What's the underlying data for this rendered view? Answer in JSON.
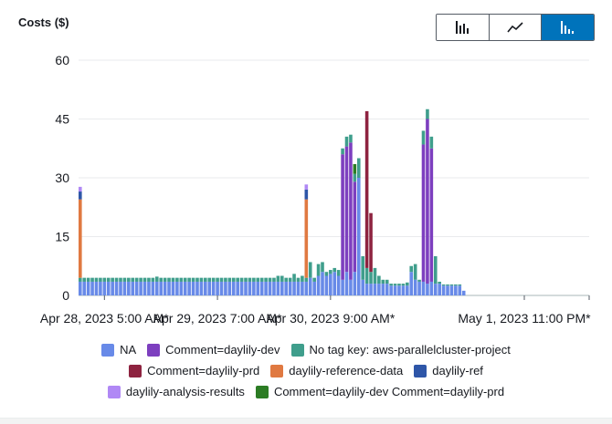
{
  "header": {
    "title": "Costs ($)"
  },
  "toolbar": {
    "buttons": [
      {
        "icon": "bar-chart-icon",
        "active": false
      },
      {
        "icon": "line-chart-icon",
        "active": false
      },
      {
        "icon": "stacked-bar-chart-icon",
        "active": true
      }
    ]
  },
  "chart_data": {
    "type": "bar",
    "stacked": true,
    "ylim": [
      0,
      60
    ],
    "yticks": [
      0,
      15,
      30,
      45,
      60
    ],
    "xlabel": "",
    "ylabel": "",
    "grid": true,
    "legend_position": "bottom",
    "x_tick_labels": [
      "Apr 28, 2023 5:00 AM*",
      "Apr 29, 2023 7:00 AM*",
      "Apr 30, 2023 9:00 AM*",
      "May 1, 2023 11:00 PM*"
    ],
    "x_tick_bar_index": [
      6,
      34,
      62,
      110
    ],
    "colors": {
      "NA": "#688ae8",
      "Comment=daylily-dev": "#7d3fbf",
      "No tag key: aws-parallelcluster-project": "#3f9e8c",
      "Comment=daylily-prd": "#8e2340",
      "daylily-reference-data": "#e07941",
      "daylily-ref": "#2e56a8",
      "daylily-analysis-results": "#b088f5",
      "Comment=daylily-dev Comment=daylily-prd": "#2c7c24"
    },
    "series_names": [
      "NA",
      "Comment=daylily-dev",
      "No tag key: aws-parallelcluster-project",
      "Comment=daylily-prd",
      "daylily-reference-data",
      "daylily-ref",
      "daylily-analysis-results",
      "Comment=daylily-dev Comment=daylily-prd"
    ],
    "bars": [
      [
        3.5,
        0,
        1,
        0,
        20,
        2,
        1.2,
        0
      ],
      [
        3.5,
        0,
        1
      ],
      [
        3.5,
        0,
        1
      ],
      [
        3.5,
        0,
        1
      ],
      [
        3.5,
        0,
        1
      ],
      [
        3.5,
        0,
        1
      ],
      [
        3.5,
        0,
        1
      ],
      [
        3.5,
        0,
        1
      ],
      [
        3.5,
        0,
        1
      ],
      [
        3.5,
        0,
        1
      ],
      [
        3.5,
        0,
        1
      ],
      [
        3.5,
        0,
        1
      ],
      [
        3.5,
        0,
        1
      ],
      [
        3.5,
        0,
        1
      ],
      [
        3.5,
        0,
        1
      ],
      [
        3.5,
        0,
        1
      ],
      [
        3.5,
        0,
        1
      ],
      [
        3.5,
        0,
        1
      ],
      [
        3.5,
        0,
        1
      ],
      [
        3.5,
        0,
        1.3
      ],
      [
        3.5,
        0,
        1
      ],
      [
        3.5,
        0,
        1
      ],
      [
        3.5,
        0,
        1
      ],
      [
        3.5,
        0,
        1
      ],
      [
        3.5,
        0,
        1
      ],
      [
        3.5,
        0,
        1
      ],
      [
        3.5,
        0,
        1
      ],
      [
        3.5,
        0,
        1
      ],
      [
        3.5,
        0,
        1
      ],
      [
        3.5,
        0,
        1
      ],
      [
        3.5,
        0,
        1
      ],
      [
        3.5,
        0,
        1
      ],
      [
        3.5,
        0,
        1
      ],
      [
        3.5,
        0,
        1
      ],
      [
        3.5,
        0,
        1
      ],
      [
        3.5,
        0,
        1
      ],
      [
        3.5,
        0,
        1
      ],
      [
        3.5,
        0,
        1
      ],
      [
        3.5,
        0,
        1
      ],
      [
        3.5,
        0,
        1
      ],
      [
        3.5,
        0,
        1
      ],
      [
        3.5,
        0,
        1
      ],
      [
        3.5,
        0,
        1
      ],
      [
        3.5,
        0,
        1
      ],
      [
        3.5,
        0,
        1
      ],
      [
        3.5,
        0,
        1
      ],
      [
        3.5,
        0,
        1
      ],
      [
        3.5,
        0,
        1
      ],
      [
        3.5,
        0,
        1
      ],
      [
        3.5,
        0,
        1.5
      ],
      [
        3.5,
        0,
        1.5
      ],
      [
        3.5,
        0,
        1
      ],
      [
        3.5,
        0,
        1
      ],
      [
        3.5,
        0,
        2
      ],
      [
        3.5,
        0,
        1
      ],
      [
        3.5,
        0,
        1.5
      ],
      [
        3.5,
        0,
        1,
        0,
        20,
        2.5,
        1.3,
        0
      ],
      [
        4.5,
        0,
        4
      ],
      [
        3.5,
        0,
        1
      ],
      [
        5,
        0,
        3
      ],
      [
        6,
        0,
        2.5
      ],
      [
        5,
        0,
        1
      ],
      [
        5.5,
        0,
        1
      ],
      [
        6,
        0,
        1
      ],
      [
        5,
        0,
        1.5
      ],
      [
        4,
        32,
        1.5
      ],
      [
        6,
        32,
        2.5
      ],
      [
        4,
        35,
        2
      ],
      [
        6,
        23,
        2,
        0,
        0,
        0,
        0,
        2.5
      ],
      [
        30,
        0,
        5,
        0,
        0,
        0,
        0,
        0
      ],
      [
        4,
        0,
        6,
        0,
        0,
        0,
        0,
        0
      ],
      [
        3,
        0,
        4,
        40,
        0,
        0,
        0,
        0
      ],
      [
        3,
        0,
        3,
        15,
        0,
        0,
        0,
        0
      ],
      [
        3,
        0,
        4
      ],
      [
        3,
        0,
        2
      ],
      [
        3,
        0,
        1
      ],
      [
        3,
        0,
        1
      ],
      [
        2.5,
        0,
        0.5
      ],
      [
        2.5,
        0,
        0.5
      ],
      [
        2.5,
        0,
        0.5
      ],
      [
        2.5,
        0,
        0.5
      ],
      [
        2.5,
        0,
        0.8
      ],
      [
        6,
        0,
        1.5
      ],
      [
        4,
        0,
        4
      ],
      [
        3.5,
        0,
        0.5
      ],
      [
        3.5,
        35,
        3.5
      ],
      [
        3,
        42,
        2.5
      ],
      [
        3.5,
        34,
        3,
        0,
        0,
        0,
        0,
        0
      ],
      [
        3,
        0,
        7
      ],
      [
        3,
        0,
        0.5
      ],
      [
        2.5,
        0,
        0.3
      ],
      [
        2.5,
        0,
        0.3
      ],
      [
        2.5,
        0,
        0.3
      ],
      [
        2.5,
        0,
        0.3
      ],
      [
        2.5,
        0,
        0.3
      ],
      [
        1.2,
        0,
        0
      ]
    ]
  },
  "legend": [
    {
      "row": 0,
      "label": "NA",
      "color": "#688ae8"
    },
    {
      "row": 0,
      "label": "Comment=daylily-dev",
      "color": "#7d3fbf"
    },
    {
      "row": 0,
      "label": "No tag key: aws-parallelcluster-project",
      "color": "#3f9e8c"
    },
    {
      "row": 1,
      "label": "Comment=daylily-prd",
      "color": "#8e2340"
    },
    {
      "row": 1,
      "label": "daylily-reference-data",
      "color": "#e07941"
    },
    {
      "row": 1,
      "label": "daylily-ref",
      "color": "#2e56a8"
    },
    {
      "row": 2,
      "label": "daylily-analysis-results",
      "color": "#b088f5"
    },
    {
      "row": 2,
      "label": "Comment=daylily-dev Comment=daylily-prd",
      "color": "#2c7c24"
    }
  ]
}
